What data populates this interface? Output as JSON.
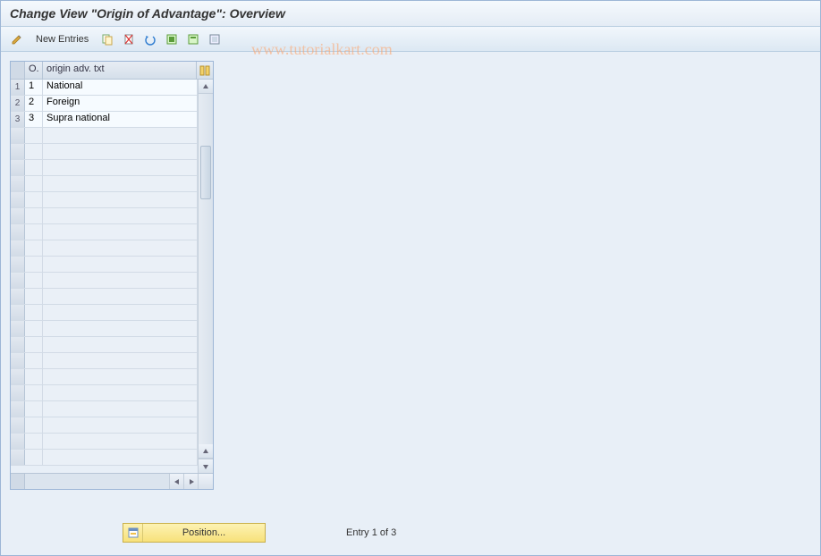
{
  "title": "Change View \"Origin of Advantage\": Overview",
  "toolbar": {
    "new_entries_label": "New Entries"
  },
  "watermark": "www.tutorialkart.com",
  "grid": {
    "columns": {
      "col1": "O.",
      "col2": "origin adv. txt"
    },
    "rows": [
      {
        "idx": "1",
        "o": "1",
        "txt": "National"
      },
      {
        "idx": "2",
        "o": "2",
        "txt": "Foreign"
      },
      {
        "idx": "3",
        "o": "3",
        "txt": "Supra national"
      }
    ],
    "empty_row_count": 21
  },
  "footer": {
    "position_label": "Position...",
    "entry_status": "Entry 1 of 3"
  }
}
